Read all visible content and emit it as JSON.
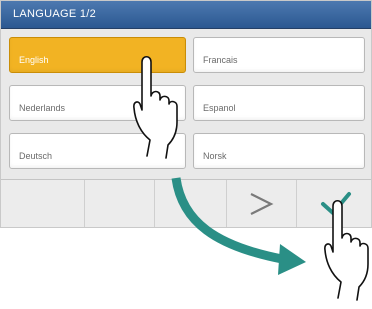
{
  "header": {
    "title": "LANGUAGE  1/2"
  },
  "languages": [
    {
      "label": "English",
      "selected": true
    },
    {
      "label": "Francais",
      "selected": false
    },
    {
      "label": "Nederlands",
      "selected": false
    },
    {
      "label": "Espanol",
      "selected": false
    },
    {
      "label": "Deutsch",
      "selected": false
    },
    {
      "label": "Norsk",
      "selected": false
    }
  ],
  "footer": {
    "next_icon": "chevron-right-icon",
    "confirm_icon": "checkmark-icon"
  },
  "colors": {
    "title_bar": "#2b5891",
    "selected": "#f2b323",
    "confirm": "#2a8f86",
    "arrow": "#2a8f86"
  }
}
